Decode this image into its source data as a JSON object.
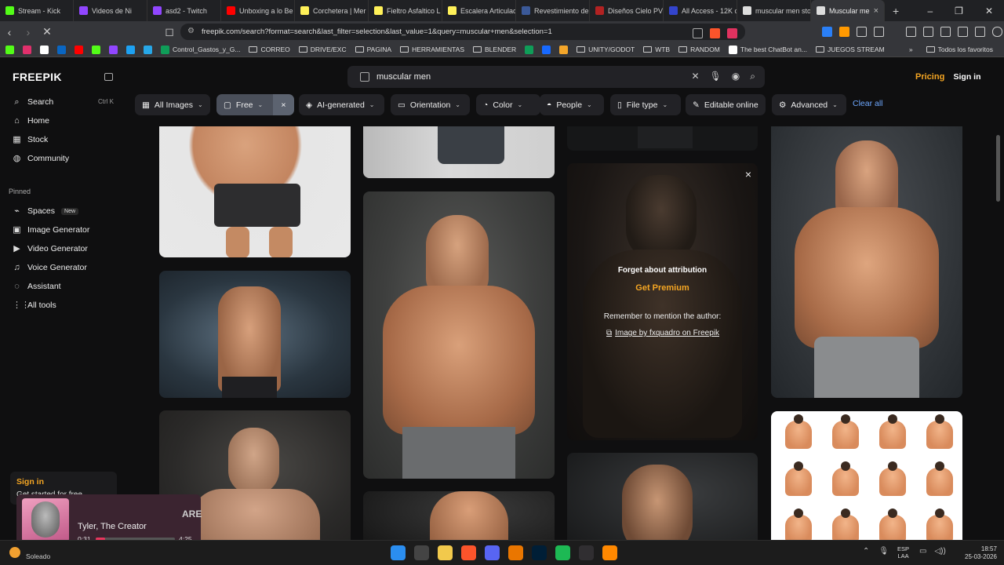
{
  "browser": {
    "tabs": [
      {
        "title": "Stream - Kick",
        "color": "#53fc18"
      },
      {
        "title": "Videos de Ni",
        "color": "#9146ff"
      },
      {
        "title": "asd2 - Twitch",
        "color": "#9146ff"
      },
      {
        "title": "Unboxing a lo Be",
        "color": "#ff0000"
      },
      {
        "title": "Corchetera | Mer",
        "color": "#fff159"
      },
      {
        "title": "Fieltro Asfaltico L",
        "color": "#fff159"
      },
      {
        "title": "Escalera Articulad",
        "color": "#fff159"
      },
      {
        "title": "Revestimiento de",
        "color": "#3b5998"
      },
      {
        "title": "Diseños Cielo PVC",
        "color": "#b22222"
      },
      {
        "title": "All Access - 12K c",
        "color": "#3344cc"
      },
      {
        "title": "muscular men sto",
        "color": "#dddddd"
      },
      {
        "title": "Muscular me",
        "color": "#dddddd"
      }
    ],
    "active_close": "×",
    "new_tab": "+",
    "window_controls": [
      "–",
      "❐",
      "✕"
    ],
    "url": "freepik.com/search?format=search&last_filter=selection&last_value=1&query=muscular+men&selection=1",
    "bookmarks": [
      {
        "label": "",
        "type": "icon",
        "color": "#53fc18"
      },
      {
        "label": "",
        "type": "icon",
        "color": "#e1306c"
      },
      {
        "label": "",
        "type": "icon",
        "color": "#ffffff"
      },
      {
        "label": "",
        "type": "icon",
        "color": "#0a66c2"
      },
      {
        "label": "",
        "type": "icon",
        "color": "#ff0000"
      },
      {
        "label": "",
        "type": "icon",
        "color": "#53fc18"
      },
      {
        "label": "",
        "type": "icon",
        "color": "#9146ff"
      },
      {
        "label": "",
        "type": "icon",
        "color": "#1da1f2"
      },
      {
        "label": "",
        "type": "icon",
        "color": "#27a7e7"
      },
      {
        "label": "Control_Gastos_y_G...",
        "type": "icon",
        "color": "#0f9d58"
      },
      {
        "label": "CORREO",
        "type": "folder"
      },
      {
        "label": "DRIVE/EXC",
        "type": "folder"
      },
      {
        "label": "PAGINA",
        "type": "folder"
      },
      {
        "label": "HERRAMIENTAS",
        "type": "folder"
      },
      {
        "label": "BLENDER",
        "type": "folder"
      },
      {
        "label": "",
        "type": "icon",
        "color": "#0f9d58"
      },
      {
        "label": "",
        "type": "icon",
        "color": "#1769ff"
      },
      {
        "label": "",
        "type": "icon",
        "color": "#f4a62a"
      },
      {
        "label": "UNITY/GODOT",
        "type": "folder"
      },
      {
        "label": "WTB",
        "type": "folder"
      },
      {
        "label": "RANDOM",
        "type": "folder"
      },
      {
        "label": "The best ChatBot an...",
        "type": "icon",
        "color": "#ffffff"
      },
      {
        "label": "JUEGOS STREAM",
        "type": "folder"
      }
    ],
    "bookmarks_more": "»",
    "all_favorites": "Todos los favoritos"
  },
  "sidebar": {
    "logo": "FREEPIK",
    "nav": [
      {
        "label": "Search",
        "icon": "search-icon",
        "glyph": "⌕",
        "shortcut": "Ctrl K"
      },
      {
        "label": "Home",
        "icon": "home-icon",
        "glyph": "⌂"
      },
      {
        "label": "Stock",
        "icon": "stock-icon",
        "glyph": "▦"
      },
      {
        "label": "Community",
        "icon": "globe-icon",
        "glyph": "◍"
      }
    ],
    "pinned_label": "Pinned",
    "pinned": [
      {
        "label": "Spaces",
        "icon": "spaces-icon",
        "glyph": "⌁",
        "badge": "New"
      },
      {
        "label": "Image Generator",
        "icon": "image-generator-icon",
        "glyph": "▣"
      },
      {
        "label": "Video Generator",
        "icon": "video-generator-icon",
        "glyph": "▶"
      },
      {
        "label": "Voice Generator",
        "icon": "voice-generator-icon",
        "glyph": "♫"
      },
      {
        "label": "Assistant",
        "icon": "assistant-icon",
        "glyph": "◌"
      },
      {
        "label": "All tools",
        "icon": "all-tools-icon",
        "glyph": "⋮⋮"
      }
    ],
    "signin_card": {
      "title": "Sign in",
      "subtitle": "Get started for free"
    }
  },
  "header": {
    "search_value": "muscular men",
    "pricing": "Pricing",
    "signin": "Sign in"
  },
  "filters": {
    "chips": [
      {
        "label": "All Images",
        "icon": "▦"
      },
      {
        "label": "Free",
        "icon": "▢"
      },
      {
        "label": "AI-generated",
        "icon": "◈"
      },
      {
        "label": "Orientation",
        "icon": "▭"
      },
      {
        "label": "Color",
        "icon": "◔"
      },
      {
        "label": "People",
        "icon": "◓"
      },
      {
        "label": "File type",
        "icon": "▯"
      },
      {
        "label": "Editable online",
        "icon": "✎"
      },
      {
        "label": "Advanced",
        "icon": "⚙"
      }
    ],
    "clear": "Clear all",
    "free_remove": "×"
  },
  "overlay": {
    "title": "Forget about attribution",
    "premium": "Get Premium",
    "mention": "Remember to mention the author:",
    "credit": "Image by fxquadro on Freepik",
    "close": "×"
  },
  "player": {
    "artist": "Tyler, The Creator",
    "elapsed": "0:31",
    "duration": "4:25",
    "progress": 0.12,
    "cover_text": "ARE"
  },
  "taskbar": {
    "weather": "Soleado",
    "lang_top": "ESP",
    "lang_bottom": "LAA",
    "time": "18:57",
    "date": "25-03-2026",
    "apps": [
      {
        "name": "windows-start",
        "color": "#2b8ef0"
      },
      {
        "name": "search",
        "color": "#444444"
      },
      {
        "name": "file-explorer",
        "color": "#f2c94c"
      },
      {
        "name": "brave",
        "color": "#fb542b"
      },
      {
        "name": "discord",
        "color": "#5865f2"
      },
      {
        "name": "blender",
        "color": "#ea7600"
      },
      {
        "name": "photoshop",
        "color": "#001e36"
      },
      {
        "name": "spotify",
        "color": "#1db954"
      },
      {
        "name": "obs",
        "color": "#302e31"
      },
      {
        "name": "vlc",
        "color": "#ff8800"
      }
    ]
  }
}
